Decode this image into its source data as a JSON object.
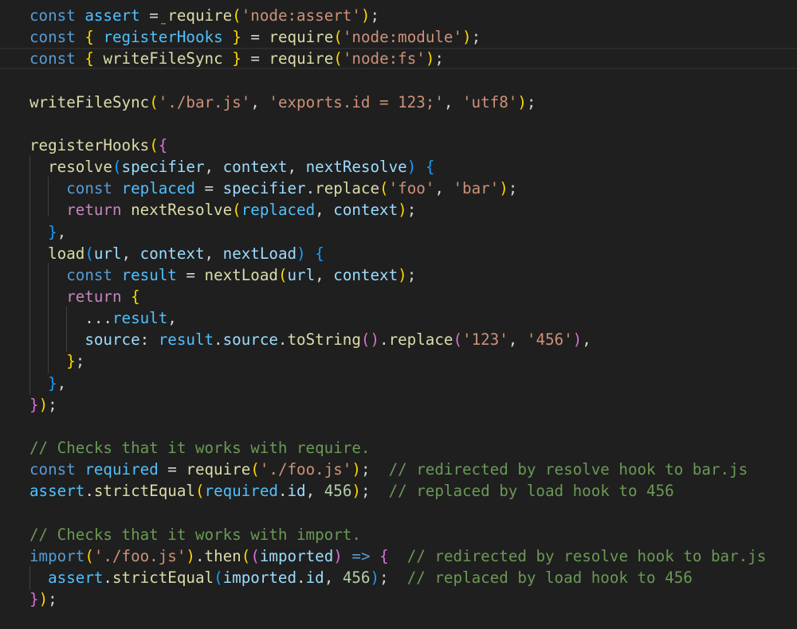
{
  "editor": {
    "language": "javascript",
    "theme": {
      "background": "#1f1f1f",
      "keyword": "#569cd6",
      "control_keyword": "#c586c0",
      "variable": "#9cdcfe",
      "constant": "#4fc1ff",
      "function": "#dcdcaa",
      "string": "#ce9178",
      "number": "#b5cea8",
      "comment": "#6a9955",
      "bracket_level_1": "#ffd700",
      "bracket_level_2": "#da70d6",
      "bracket_level_3": "#179fff"
    },
    "lines": [
      [
        [
          "kw",
          "const"
        ],
        [
          "op",
          " "
        ],
        [
          "cst",
          "assert"
        ],
        [
          "op",
          " = "
        ],
        [
          "fn",
          "require"
        ],
        [
          "b1",
          "("
        ],
        [
          "str",
          "'node:assert'"
        ],
        [
          "b1",
          ")"
        ],
        [
          "op",
          ";"
        ]
      ],
      [
        [
          "kw",
          "const"
        ],
        [
          "op",
          " "
        ],
        [
          "b1",
          "{"
        ],
        [
          "op",
          " "
        ],
        [
          "cst",
          "registerHooks"
        ],
        [
          "op",
          " "
        ],
        [
          "b1",
          "}"
        ],
        [
          "op",
          " = "
        ],
        [
          "fn",
          "require"
        ],
        [
          "b1",
          "("
        ],
        [
          "str",
          "'node:module'"
        ],
        [
          "b1",
          ")"
        ],
        [
          "op",
          ";"
        ]
      ],
      [
        [
          "kw",
          "const"
        ],
        [
          "op",
          " "
        ],
        [
          "b1",
          "{"
        ],
        [
          "op",
          " "
        ],
        [
          "fn",
          "writeFileSync"
        ],
        [
          "op",
          " "
        ],
        [
          "b1",
          "}"
        ],
        [
          "op",
          " = "
        ],
        [
          "fn",
          "require"
        ],
        [
          "b1",
          "("
        ],
        [
          "str",
          "'node:fs'"
        ],
        [
          "b1",
          ")"
        ],
        [
          "op",
          ";"
        ]
      ],
      [],
      [
        [
          "fn",
          "writeFileSync"
        ],
        [
          "b1",
          "("
        ],
        [
          "str",
          "'./bar.js'"
        ],
        [
          "op",
          ", "
        ],
        [
          "str",
          "'exports.id = 123;'"
        ],
        [
          "op",
          ", "
        ],
        [
          "str",
          "'utf8'"
        ],
        [
          "b1",
          ")"
        ],
        [
          "op",
          ";"
        ]
      ],
      [],
      [
        [
          "fn",
          "registerHooks"
        ],
        [
          "b1",
          "("
        ],
        [
          "b2",
          "{"
        ]
      ],
      [
        [
          "op",
          "  "
        ],
        [
          "fn",
          "resolve"
        ],
        [
          "b3",
          "("
        ],
        [
          "var",
          "specifier"
        ],
        [
          "op",
          ", "
        ],
        [
          "var",
          "context"
        ],
        [
          "op",
          ", "
        ],
        [
          "var",
          "nextResolve"
        ],
        [
          "b3",
          ")"
        ],
        [
          "op",
          " "
        ],
        [
          "b3",
          "{"
        ]
      ],
      [
        [
          "op",
          "    "
        ],
        [
          "kw",
          "const"
        ],
        [
          "op",
          " "
        ],
        [
          "cst",
          "replaced"
        ],
        [
          "op",
          " = "
        ],
        [
          "var",
          "specifier"
        ],
        [
          "op",
          "."
        ],
        [
          "fn",
          "replace"
        ],
        [
          "b1",
          "("
        ],
        [
          "str",
          "'foo'"
        ],
        [
          "op",
          ", "
        ],
        [
          "str",
          "'bar'"
        ],
        [
          "b1",
          ")"
        ],
        [
          "op",
          ";"
        ]
      ],
      [
        [
          "op",
          "    "
        ],
        [
          "kw2",
          "return"
        ],
        [
          "op",
          " "
        ],
        [
          "fn",
          "nextResolve"
        ],
        [
          "b1",
          "("
        ],
        [
          "cst",
          "replaced"
        ],
        [
          "op",
          ", "
        ],
        [
          "var",
          "context"
        ],
        [
          "b1",
          ")"
        ],
        [
          "op",
          ";"
        ]
      ],
      [
        [
          "op",
          "  "
        ],
        [
          "b3",
          "}"
        ],
        [
          "op",
          ","
        ]
      ],
      [
        [
          "op",
          "  "
        ],
        [
          "fn",
          "load"
        ],
        [
          "b3",
          "("
        ],
        [
          "var",
          "url"
        ],
        [
          "op",
          ", "
        ],
        [
          "var",
          "context"
        ],
        [
          "op",
          ", "
        ],
        [
          "var",
          "nextLoad"
        ],
        [
          "b3",
          ")"
        ],
        [
          "op",
          " "
        ],
        [
          "b3",
          "{"
        ]
      ],
      [
        [
          "op",
          "    "
        ],
        [
          "kw",
          "const"
        ],
        [
          "op",
          " "
        ],
        [
          "cst",
          "result"
        ],
        [
          "op",
          " = "
        ],
        [
          "fn",
          "nextLoad"
        ],
        [
          "b1",
          "("
        ],
        [
          "var",
          "url"
        ],
        [
          "op",
          ", "
        ],
        [
          "var",
          "context"
        ],
        [
          "b1",
          ")"
        ],
        [
          "op",
          ";"
        ]
      ],
      [
        [
          "op",
          "    "
        ],
        [
          "kw2",
          "return"
        ],
        [
          "op",
          " "
        ],
        [
          "b1",
          "{"
        ]
      ],
      [
        [
          "op",
          "      ..."
        ],
        [
          "cst",
          "result"
        ],
        [
          "op",
          ","
        ]
      ],
      [
        [
          "op",
          "      "
        ],
        [
          "var",
          "source"
        ],
        [
          "op",
          ": "
        ],
        [
          "cst",
          "result"
        ],
        [
          "op",
          "."
        ],
        [
          "var",
          "source"
        ],
        [
          "op",
          "."
        ],
        [
          "fn",
          "toString"
        ],
        [
          "b2",
          "()"
        ],
        [
          "op",
          "."
        ],
        [
          "fn",
          "replace"
        ],
        [
          "b2",
          "("
        ],
        [
          "str",
          "'123'"
        ],
        [
          "op",
          ", "
        ],
        [
          "str",
          "'456'"
        ],
        [
          "b2",
          ")"
        ],
        [
          "op",
          ","
        ]
      ],
      [
        [
          "op",
          "    "
        ],
        [
          "b1",
          "}"
        ],
        [
          "op",
          ";"
        ]
      ],
      [
        [
          "op",
          "  "
        ],
        [
          "b3",
          "}"
        ],
        [
          "op",
          ","
        ]
      ],
      [
        [
          "b2",
          "}"
        ],
        [
          "b1",
          ")"
        ],
        [
          "op",
          ";"
        ]
      ],
      [],
      [
        [
          "com",
          "// Checks that it works with require."
        ]
      ],
      [
        [
          "kw",
          "const"
        ],
        [
          "op",
          " "
        ],
        [
          "cst",
          "required"
        ],
        [
          "op",
          " = "
        ],
        [
          "fn",
          "require"
        ],
        [
          "b1",
          "("
        ],
        [
          "str",
          "'./foo.js'"
        ],
        [
          "b1",
          ")"
        ],
        [
          "op",
          ";  "
        ],
        [
          "com",
          "// redirected by resolve hook to bar.js"
        ]
      ],
      [
        [
          "cst",
          "assert"
        ],
        [
          "op",
          "."
        ],
        [
          "fn",
          "strictEqual"
        ],
        [
          "b1",
          "("
        ],
        [
          "cst",
          "required"
        ],
        [
          "op",
          "."
        ],
        [
          "var",
          "id"
        ],
        [
          "op",
          ", "
        ],
        [
          "num",
          "456"
        ],
        [
          "b1",
          ")"
        ],
        [
          "op",
          ";  "
        ],
        [
          "com",
          "// replaced by load hook to 456"
        ]
      ],
      [],
      [
        [
          "com",
          "// Checks that it works with import."
        ]
      ],
      [
        [
          "kw",
          "import"
        ],
        [
          "b1",
          "("
        ],
        [
          "str",
          "'./foo.js'"
        ],
        [
          "b1",
          ")"
        ],
        [
          "op",
          "."
        ],
        [
          "fn",
          "then"
        ],
        [
          "b1",
          "("
        ],
        [
          "b2",
          "("
        ],
        [
          "var",
          "imported"
        ],
        [
          "b2",
          ")"
        ],
        [
          "op",
          " "
        ],
        [
          "kw",
          "=>"
        ],
        [
          "op",
          " "
        ],
        [
          "b2",
          "{"
        ],
        [
          "op",
          "  "
        ],
        [
          "com",
          "// redirected by resolve hook to bar.js"
        ]
      ],
      [
        [
          "op",
          "  "
        ],
        [
          "cst",
          "assert"
        ],
        [
          "op",
          "."
        ],
        [
          "fn",
          "strictEqual"
        ],
        [
          "b3",
          "("
        ],
        [
          "var",
          "imported"
        ],
        [
          "op",
          "."
        ],
        [
          "var",
          "id"
        ],
        [
          "op",
          ", "
        ],
        [
          "num",
          "456"
        ],
        [
          "b3",
          ")"
        ],
        [
          "op",
          ";  "
        ],
        [
          "com",
          "// replaced by load hook to 456"
        ]
      ],
      [
        [
          "b2",
          "}"
        ],
        [
          "b1",
          ")"
        ],
        [
          "op",
          ";"
        ]
      ]
    ]
  }
}
